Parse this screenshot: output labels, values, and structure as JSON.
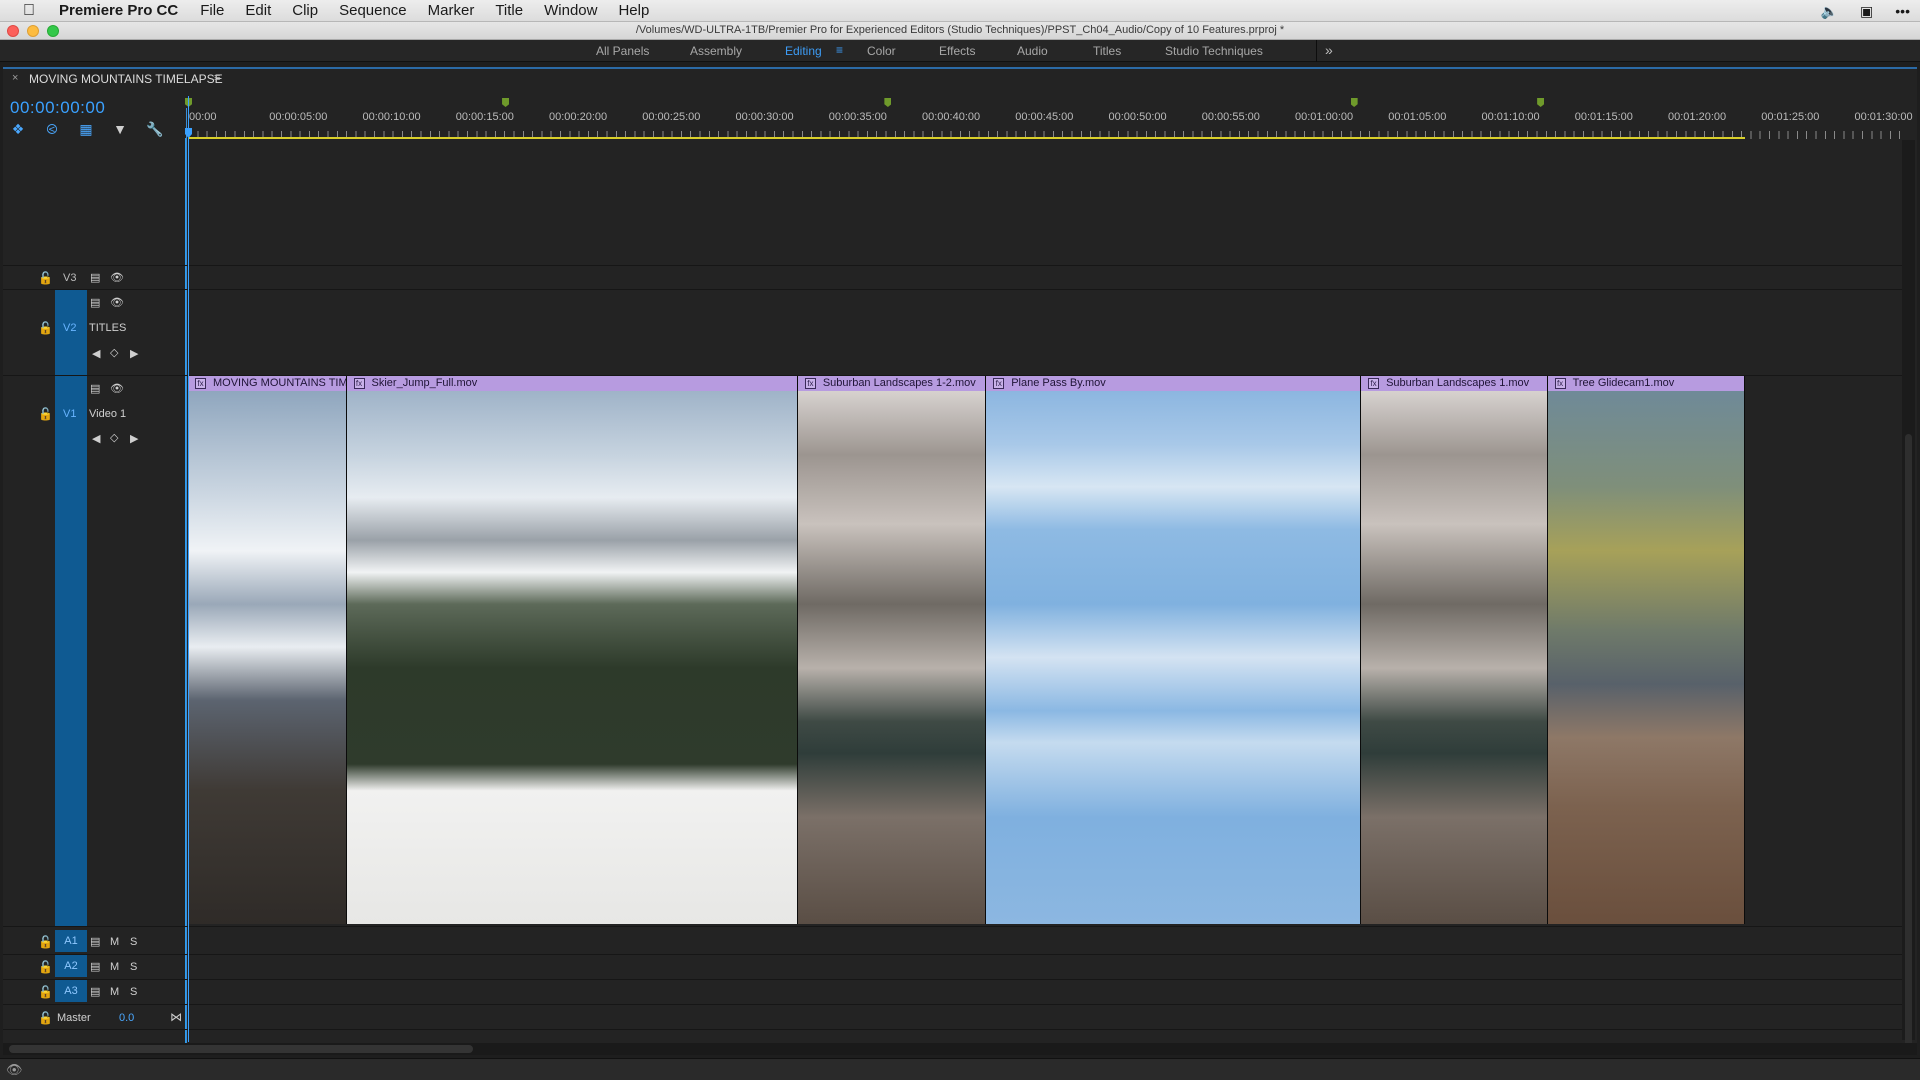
{
  "app": {
    "name": "Premiere Pro CC",
    "menus": [
      "File",
      "Edit",
      "Clip",
      "Sequence",
      "Marker",
      "Title",
      "Window",
      "Help"
    ],
    "window_title": "/Volumes/WD-ULTRA-1TB/Premier Pro for Experienced Editors (Studio Techniques)/PPST_Ch04_Audio/Copy of 10 Features.prproj *"
  },
  "workspaces": {
    "items": [
      "All Panels",
      "Assembly",
      "Editing",
      "Color",
      "Effects",
      "Audio",
      "Titles",
      "Studio Techniques"
    ],
    "active": "Editing",
    "menu_glyph": "≡",
    "overflow_glyph": "»"
  },
  "timeline": {
    "sequence_name": "MOVING MOUNTAINS TIMELAPSE",
    "tab_close": "×",
    "tab_menu": "≡",
    "timecode": "00:00:00:00",
    "ruler_labels": [
      "00:00",
      "00:00:05:00",
      "00:00:10:00",
      "00:00:15:00",
      "00:00:20:00",
      "00:00:25:00",
      "00:00:30:00",
      "00:00:35:00",
      "00:00:40:00",
      "00:00:45:00",
      "00:00:50:00",
      "00:00:55:00",
      "00:01:00:00",
      "00:01:05:00",
      "00:01:10:00",
      "00:01:15:00",
      "00:01:20:00",
      "00:01:25:00",
      "00:01:30:00"
    ],
    "markers_seconds": [
      0,
      17,
      37.5,
      62.5,
      72.5
    ],
    "work_area_end_seconds": 83.5,
    "video_tracks": [
      {
        "id": "V3",
        "name": ""
      },
      {
        "id": "V2",
        "name": "TITLES"
      },
      {
        "id": "V1",
        "name": "Video 1"
      }
    ],
    "audio_tracks": [
      {
        "id": "A1",
        "m": "M",
        "s": "S"
      },
      {
        "id": "A2",
        "m": "M",
        "s": "S"
      },
      {
        "id": "A3",
        "m": "M",
        "s": "S"
      }
    ],
    "master": {
      "label": "Master",
      "value": "0.0"
    },
    "clips": [
      {
        "name": "MOVING MOUNTAINS TIMELAPSE",
        "start_seconds": 0,
        "end_seconds": 8.5,
        "palette": "mountain"
      },
      {
        "name": "Skier_Jump_Full.mov",
        "start_seconds": 8.5,
        "end_seconds": 32.7,
        "palette": "skier"
      },
      {
        "name": "Suburban Landscapes 1-2.mov",
        "start_seconds": 32.7,
        "end_seconds": 42.8,
        "palette": "forest"
      },
      {
        "name": "Plane Pass By.mov",
        "start_seconds": 42.8,
        "end_seconds": 62.9,
        "palette": "sky"
      },
      {
        "name": "Suburban Landscapes 1.mov",
        "start_seconds": 62.9,
        "end_seconds": 72.9,
        "palette": "forest"
      },
      {
        "name": "Tree Glidecam1.mov",
        "start_seconds": 72.9,
        "end_seconds": 83.5,
        "palette": "trees"
      }
    ],
    "colors": {
      "accent": "#3aa1ff",
      "clip_label": "#b79be0",
      "track_target": "#0f5a92",
      "work_area": "#d8cf2a",
      "marker": "#6f9a2b"
    }
  }
}
